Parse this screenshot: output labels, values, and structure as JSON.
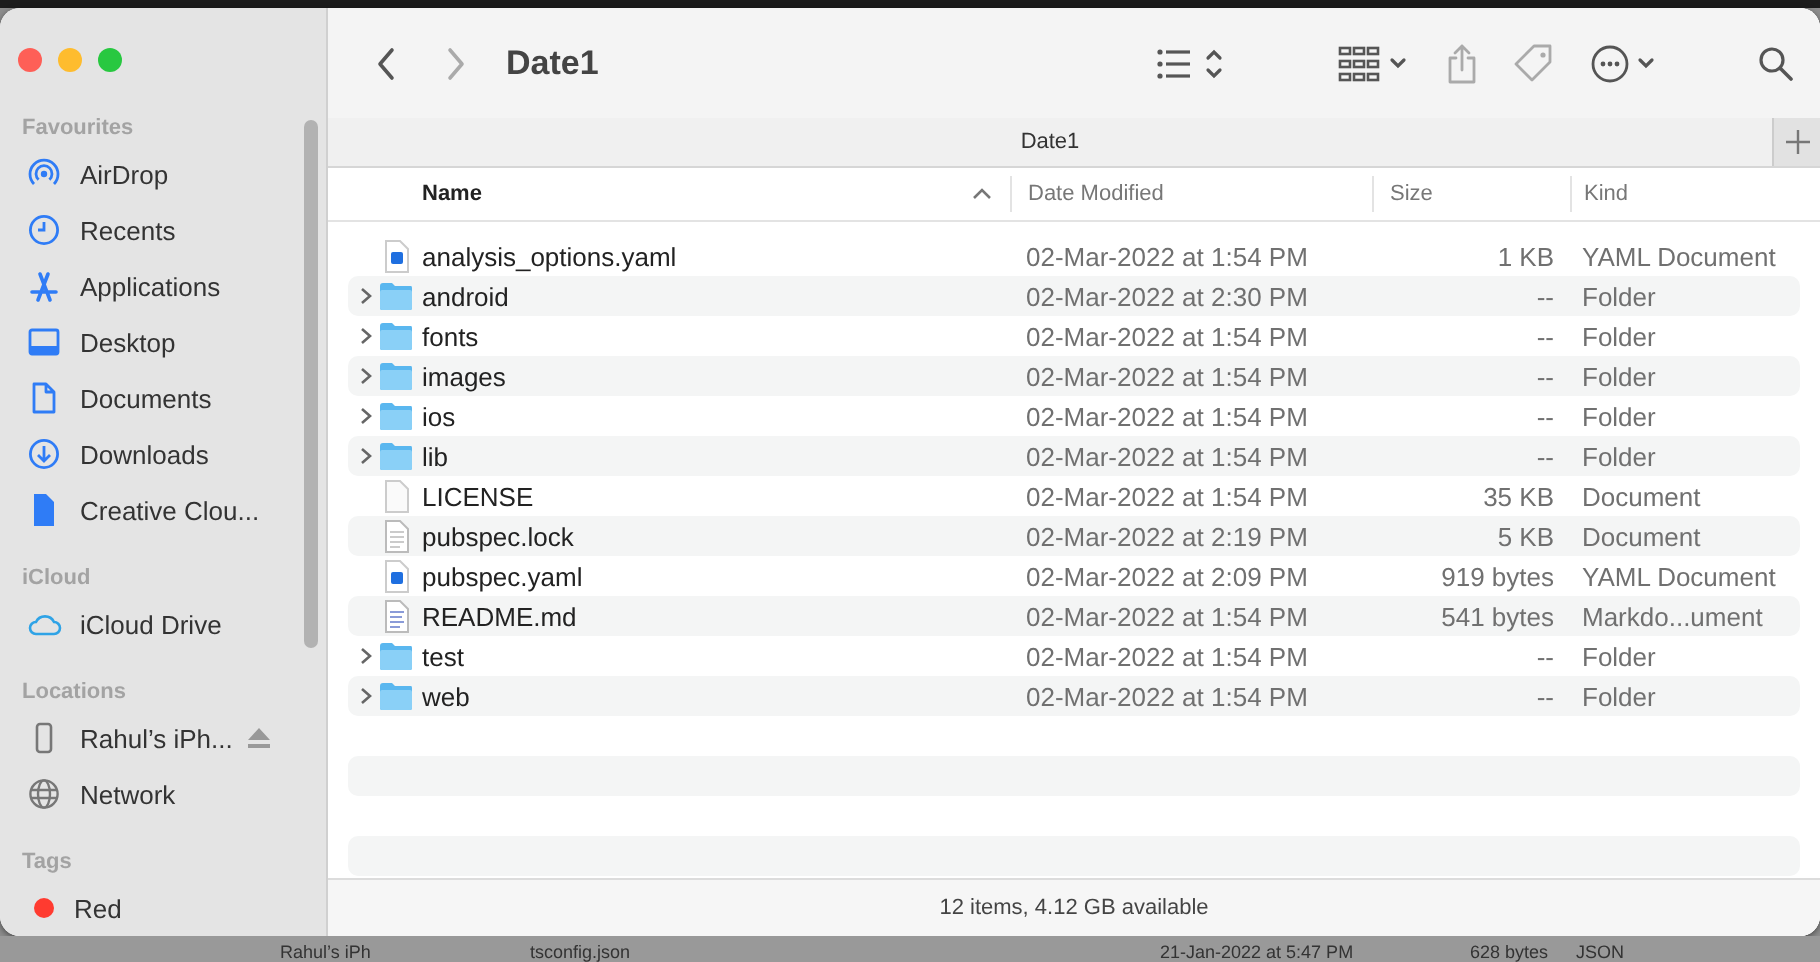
{
  "window": {
    "title": "Date1",
    "tab_title": "Date1"
  },
  "sidebar": {
    "sections": [
      {
        "heading": "Favourites",
        "items": [
          {
            "label": "AirDrop",
            "kind": "airdrop"
          },
          {
            "label": "Recents",
            "kind": "clock"
          },
          {
            "label": "Applications",
            "kind": "apps"
          },
          {
            "label": "Desktop",
            "kind": "desktop"
          },
          {
            "label": "Documents",
            "kind": "document"
          },
          {
            "label": "Downloads",
            "kind": "download"
          },
          {
            "label": "Creative Clou...",
            "kind": "file"
          }
        ]
      },
      {
        "heading": "iCloud",
        "items": [
          {
            "label": "iCloud Drive",
            "kind": "cloud"
          }
        ]
      },
      {
        "heading": "Locations",
        "items": [
          {
            "label": "Rahul’s iPh...",
            "kind": "phone",
            "ejectable": true
          },
          {
            "label": "Network",
            "kind": "globe"
          }
        ]
      },
      {
        "heading": "Tags",
        "items": [
          {
            "label": "Red",
            "kind": "tag",
            "color": "#ff3b30"
          }
        ]
      }
    ]
  },
  "table": {
    "columns": [
      {
        "label": "Name",
        "sorted": true
      },
      {
        "label": "Date Modified",
        "sorted": false
      },
      {
        "label": "Size",
        "sorted": false
      },
      {
        "label": "Kind",
        "sorted": false
      }
    ],
    "rows": [
      {
        "name": "analysis_options.yaml",
        "kind": "yaml",
        "date": "02-Mar-2022 at 1:54 PM",
        "size": "1 KB",
        "type": "YAML Document"
      },
      {
        "name": "android",
        "kind": "folder",
        "expanded": false,
        "date": "02-Mar-2022 at 2:30 PM",
        "size": "--",
        "type": "Folder"
      },
      {
        "name": "fonts",
        "kind": "folder",
        "expanded": false,
        "date": "02-Mar-2022 at 1:54 PM",
        "size": "--",
        "type": "Folder"
      },
      {
        "name": "images",
        "kind": "folder",
        "expanded": false,
        "date": "02-Mar-2022 at 1:54 PM",
        "size": "--",
        "type": "Folder"
      },
      {
        "name": "ios",
        "kind": "folder",
        "expanded": false,
        "date": "02-Mar-2022 at 1:54 PM",
        "size": "--",
        "type": "Folder"
      },
      {
        "name": "lib",
        "kind": "folder",
        "expanded": false,
        "date": "02-Mar-2022 at 1:54 PM",
        "size": "--",
        "type": "Folder"
      },
      {
        "name": "LICENSE",
        "kind": "blank",
        "date": "02-Mar-2022 at 1:54 PM",
        "size": "35 KB",
        "type": "Document"
      },
      {
        "name": "pubspec.lock",
        "kind": "text",
        "date": "02-Mar-2022 at 2:19 PM",
        "size": "5 KB",
        "type": "Document"
      },
      {
        "name": "pubspec.yaml",
        "kind": "yaml",
        "date": "02-Mar-2022 at 2:09 PM",
        "size": "919 bytes",
        "type": "YAML Document"
      },
      {
        "name": "README.md",
        "kind": "markdown",
        "date": "02-Mar-2022 at 1:54 PM",
        "size": "541 bytes",
        "type": "Markdo...ument"
      },
      {
        "name": "test",
        "kind": "folder",
        "expanded": false,
        "date": "02-Mar-2022 at 1:54 PM",
        "size": "--",
        "type": "Folder"
      },
      {
        "name": "web",
        "kind": "folder",
        "expanded": false,
        "date": "02-Mar-2022 at 1:54 PM",
        "size": "--",
        "type": "Folder"
      }
    ]
  },
  "status_bar": "12 items, 4.12 GB available",
  "background_window": {
    "device": "Rahul’s iPh",
    "file": "tsconfig.json",
    "date": "21-Jan-2022 at 5:47 PM",
    "size": "628 bytes",
    "type": "JSON"
  }
}
